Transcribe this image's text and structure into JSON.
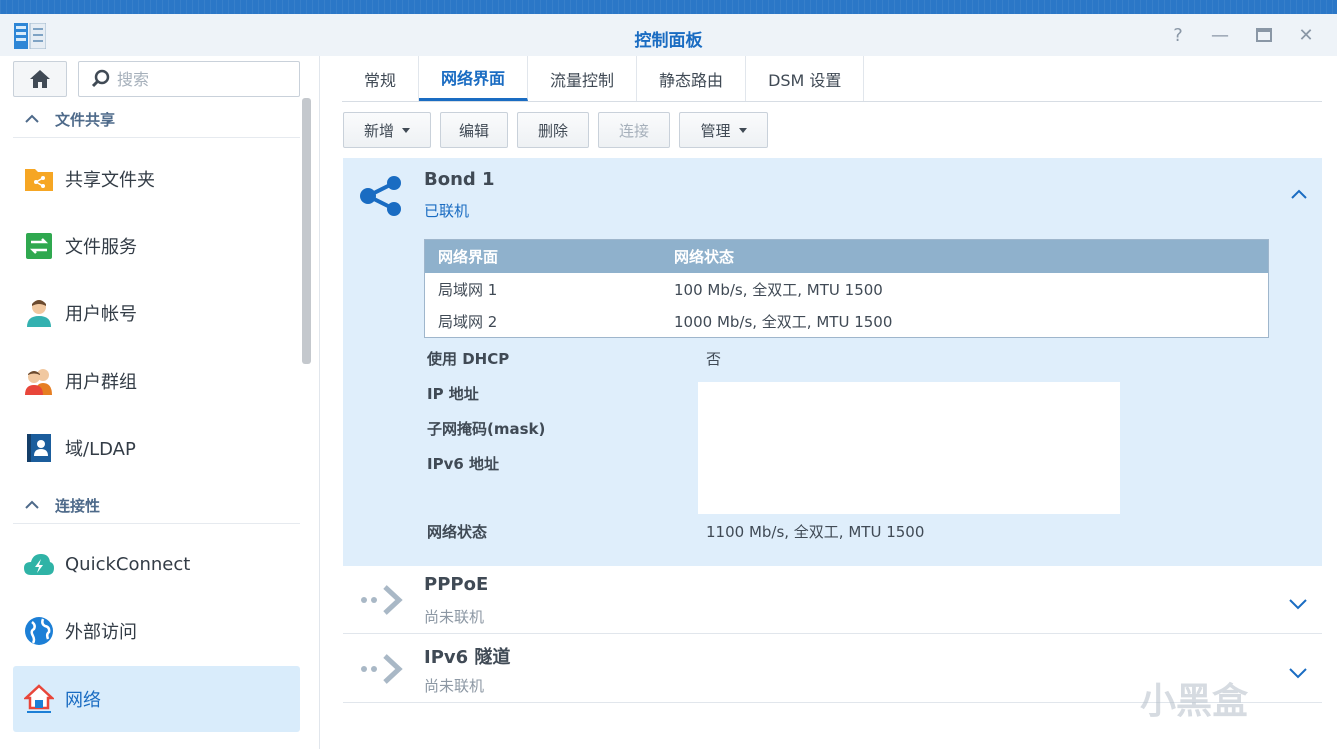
{
  "window": {
    "title": "控制面板",
    "help": "?",
    "minimize": "—",
    "close": "✕"
  },
  "sidebar": {
    "search_placeholder": "搜索",
    "sections": [
      {
        "label": "文件共享",
        "items": [
          "共享文件夹",
          "文件服务",
          "用户帐号",
          "用户群组",
          "域/LDAP"
        ]
      },
      {
        "label": "连接性",
        "items": [
          "QuickConnect",
          "外部访问",
          "网络"
        ]
      }
    ],
    "active_item": "网络"
  },
  "tabs": [
    "常规",
    "网络界面",
    "流量控制",
    "静态路由",
    "DSM 设置"
  ],
  "active_tab": "网络界面",
  "toolbar": {
    "add": "新增",
    "edit": "编辑",
    "delete": "删除",
    "connect": "连接",
    "manage": "管理"
  },
  "bond": {
    "title": "Bond 1",
    "status": "已联机",
    "table": {
      "headers": [
        "网络界面",
        "网络状态"
      ],
      "rows": [
        [
          "局域网 1",
          "100 Mb/s, 全双工, MTU 1500"
        ],
        [
          "局域网 2",
          "1000 Mb/s, 全双工, MTU 1500"
        ]
      ]
    },
    "props": {
      "dhcp_label": "使用 DHCP",
      "dhcp_value": "否",
      "ip_label": "IP 地址",
      "mask_label": "子网掩码(mask)",
      "ipv6_label": "IPv6 地址",
      "net_status_label": "网络状态",
      "net_status_value": "1100 Mb/s, 全双工, MTU 1500"
    }
  },
  "pppoe": {
    "title": "PPPoE",
    "status": "尚未联机"
  },
  "ipv6tunnel": {
    "title": "IPv6 隧道",
    "status": "尚未联机"
  },
  "watermark": "小黑盒",
  "colors": {
    "accent": "#1a6cc2",
    "panel_bg": "#dfeefb",
    "table_header": "#8fb1cc"
  }
}
